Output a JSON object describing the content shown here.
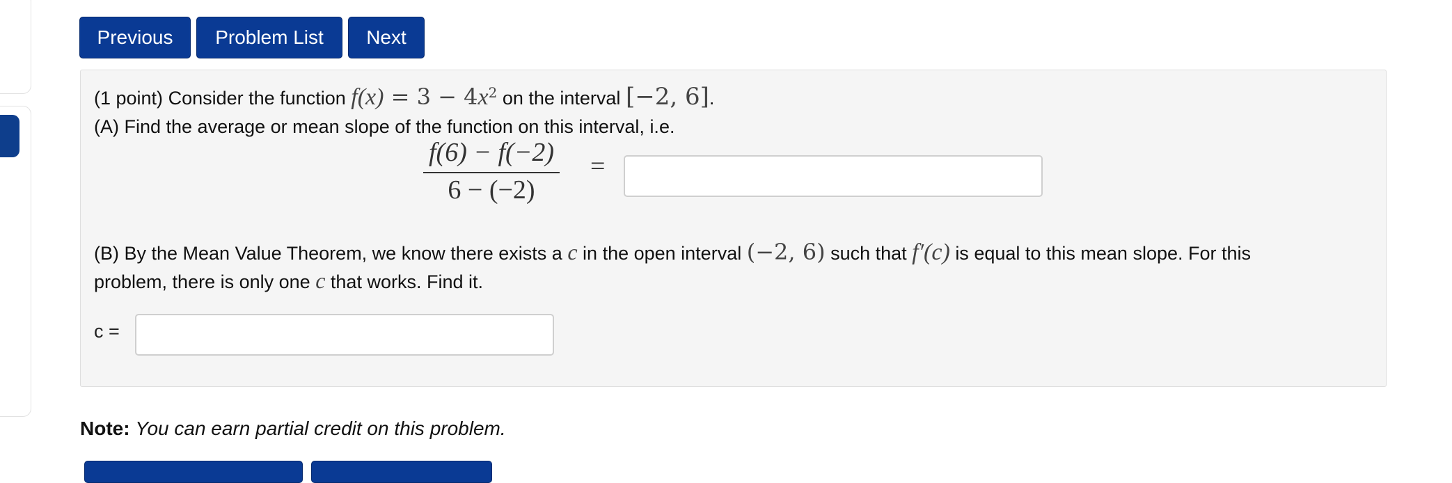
{
  "nav": {
    "previous": "Previous",
    "problem_list": "Problem List",
    "next": "Next"
  },
  "problem": {
    "points": "(1 point)",
    "intro": "Consider the function",
    "function_lhs": "f(x)",
    "function_eq": " = 3 − 4",
    "function_var": "x",
    "function_exp": "2",
    "on_interval": "on the interval",
    "interval": "[−2, 6]",
    "period": ".",
    "part_a": "(A) Find the average or mean slope of the function on this interval, i.e.",
    "fraction_numerator": "f(6) − f(−2)",
    "fraction_denominator": "6 − (−2)",
    "equals": "=",
    "answer_a_value": "",
    "part_b_1": "(B) By the Mean Value Theorem, we know there exists a",
    "c_symbol": "c",
    "part_b_2": "in the open interval",
    "open_interval": "(−2, 6)",
    "part_b_3": "such that",
    "fprime": "f′(c)",
    "part_b_4": "is equal to this mean slope. For this",
    "part_b_5": "problem, there is only one",
    "part_b_6": "that works. Find it.",
    "c_label": "c =",
    "answer_b_value": ""
  },
  "note": {
    "label": "Note:",
    "text": "You can earn partial credit on this problem."
  },
  "colors": {
    "button": "#0a3a94",
    "panel_bg": "#f5f5f5"
  }
}
